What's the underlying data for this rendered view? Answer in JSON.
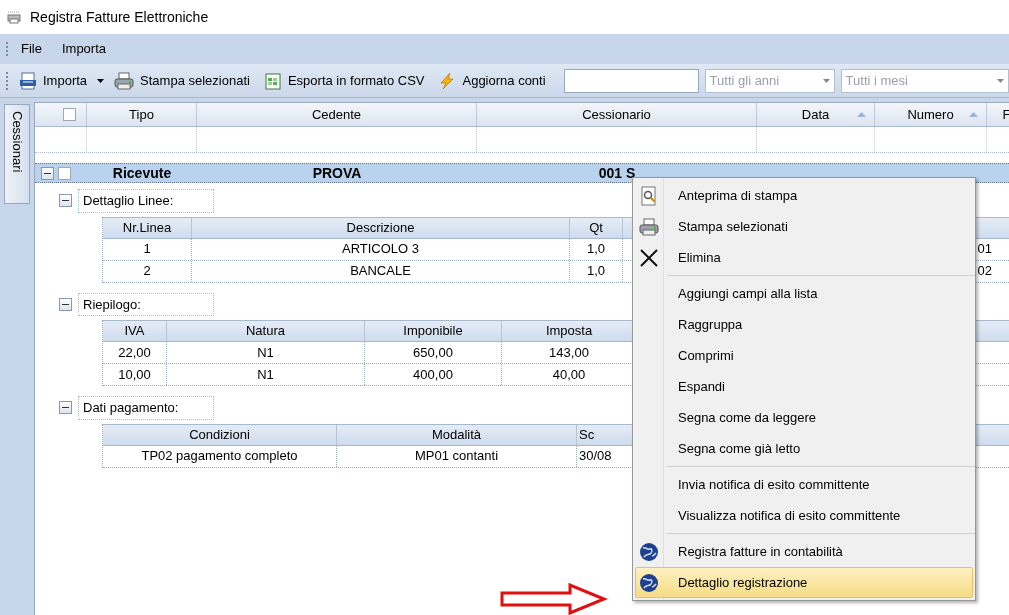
{
  "window": {
    "title": "Registra Fatture Elettroniche"
  },
  "menu_bar": [
    {
      "label": "File"
    },
    {
      "label": "Importa"
    }
  ],
  "toolbar": [
    {
      "kind": "split",
      "label": "Importa"
    },
    {
      "kind": "button",
      "label": "Stampa selezionati"
    },
    {
      "kind": "button",
      "label": "Esporta in formato CSV"
    },
    {
      "kind": "button",
      "label": "Aggiorna conti"
    },
    {
      "kind": "field"
    },
    {
      "kind": "combo",
      "placeholder": "Tutti gli anni"
    },
    {
      "kind": "combo",
      "placeholder": "Tutti i mesi"
    }
  ],
  "side_tab": {
    "label": "Cessionari"
  },
  "grid": {
    "header_checked": false,
    "columns": [
      {
        "label": "Tipo",
        "sort": false
      },
      {
        "label": "Cedente",
        "sort": false
      },
      {
        "label": "Cessionario",
        "sort": false
      },
      {
        "label": "Data",
        "sort": true
      },
      {
        "label": "Numero",
        "sort": true
      },
      {
        "label": "F"
      }
    ],
    "record": {
      "checked": false,
      "expanded": true,
      "selected": true,
      "tipo": "Ricevute",
      "cedente": "PROVA",
      "cessionario": "001 S"
    },
    "sections": [
      {
        "title": "Dettaglio Linee:",
        "expanded": true,
        "columns": [
          "Nr.Linea",
          "Descrizione",
          "Qt",
          ""
        ],
        "rows": [
          [
            "1",
            "ARTICOLO 3",
            "1,0",
            "01"
          ],
          [
            "2",
            "BANCALE",
            "1,0",
            "02"
          ]
        ]
      },
      {
        "title": "Riepilogo:",
        "expanded": true,
        "columns": [
          "IVA",
          "Natura",
          "Imponibile",
          "Imposta"
        ],
        "rows": [
          [
            "22,00",
            "N1",
            "650,00",
            "143,00"
          ],
          [
            "10,00",
            "N1",
            "400,00",
            "40,00"
          ]
        ]
      },
      {
        "title": "Dati pagamento:",
        "expanded": true,
        "columns": [
          "Condizioni",
          "Modalità",
          "Sc"
        ],
        "rows": [
          [
            "TP02 pagamento completo",
            "MP01 contanti",
            "30/08"
          ]
        ]
      }
    ]
  },
  "context_menu": [
    {
      "kind": "item",
      "label": "Anteprima di stampa",
      "selected": false
    },
    {
      "kind": "item",
      "label": "Stampa selezionati",
      "selected": false
    },
    {
      "kind": "item",
      "label": "Elimina",
      "selected": false
    },
    {
      "kind": "separator"
    },
    {
      "kind": "item",
      "label": "Aggiungi campi alla lista",
      "selected": false
    },
    {
      "kind": "item",
      "label": "Raggruppa",
      "selected": false
    },
    {
      "kind": "item",
      "label": "Comprimi",
      "selected": false
    },
    {
      "kind": "item",
      "label": "Espandi",
      "selected": false
    },
    {
      "kind": "item",
      "label": "Segna come da leggere",
      "selected": false
    },
    {
      "kind": "item",
      "label": "Segna come già letto",
      "selected": false
    },
    {
      "kind": "separator"
    },
    {
      "kind": "item",
      "label": "Invia notifica di esito committente",
      "selected": false
    },
    {
      "kind": "item",
      "label": "Visualizza notifica di esito committente",
      "selected": false
    },
    {
      "kind": "separator"
    },
    {
      "kind": "item",
      "label": "Registra fatture in contabilità",
      "selected": false
    },
    {
      "kind": "item",
      "label": "Dettaglio registrazione",
      "selected": true
    }
  ],
  "annotation": {
    "kind": "arrow"
  }
}
